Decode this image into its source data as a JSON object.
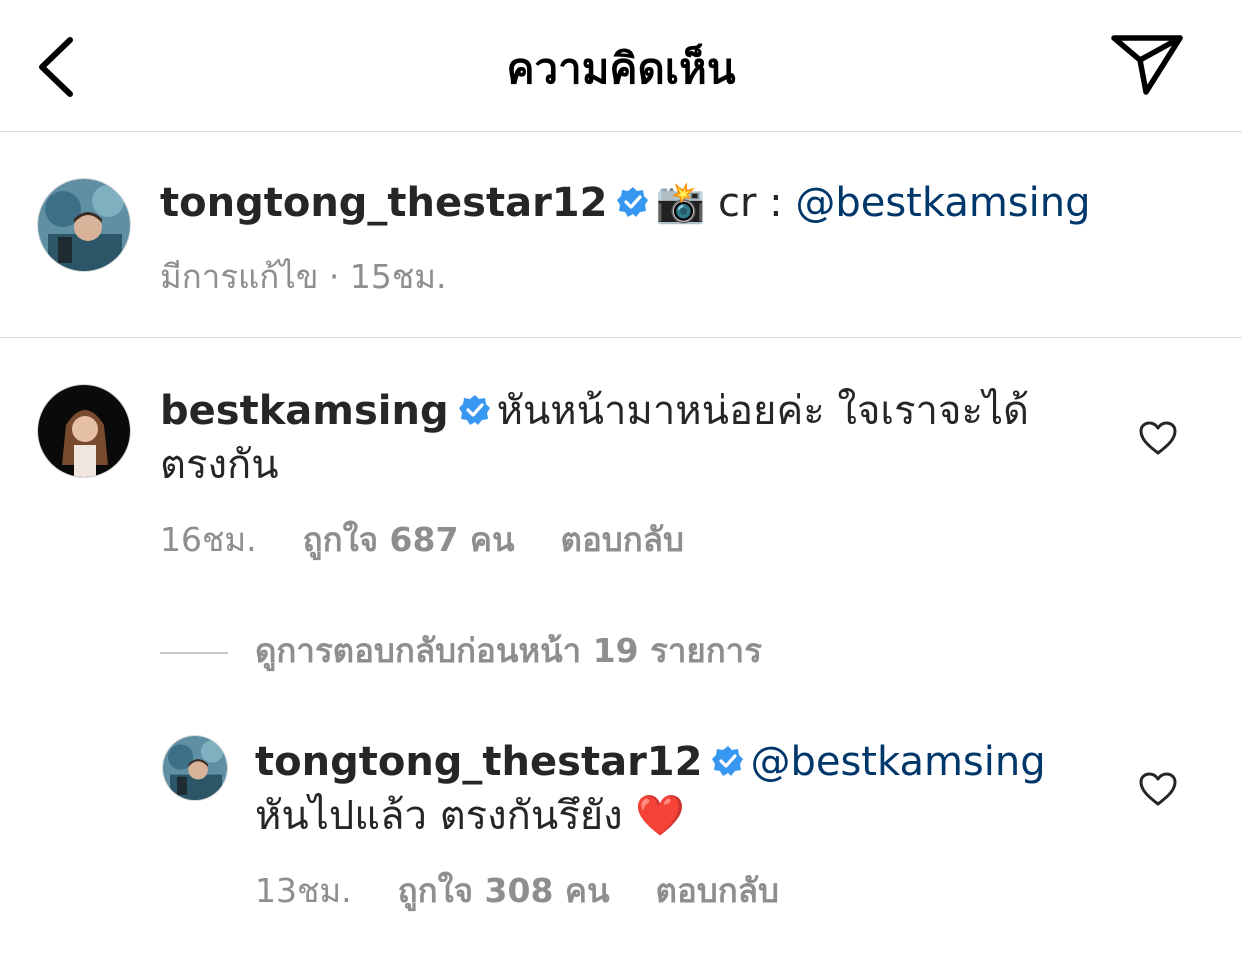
{
  "header": {
    "title": "ความคิดเห็น",
    "back_icon": "chevron-left-icon",
    "share_icon": "paper-plane-icon"
  },
  "caption": {
    "username": "tongtong_thestar12",
    "emoji": "📸",
    "text": " cr : ",
    "mention": "@bestkamsing",
    "meta": "มีการแก้ไข · 15ชม."
  },
  "comments": [
    {
      "username": "bestkamsing",
      "text": "หันหน้ามาหน่อยค่ะ ใจเราจะได้ตรงกัน",
      "time": "16ชม.",
      "likes": "ถูกใจ 687 คน",
      "reply": "ตอบกลับ"
    }
  ],
  "view_replies": "ดูการตอบกลับก่อนหน้า 19 รายการ",
  "reply": {
    "username": "tongtong_thestar12",
    "mention": "@bestkamsing",
    "text": " หันไปแล้ว ตรงกันรึยัง ",
    "emoji": "❤️",
    "time": "13ชม.",
    "likes": "ถูกใจ 308 คน",
    "reply": "ตอบกลับ"
  },
  "colors": {
    "verified": "#3897f0",
    "mention": "#00376b",
    "meta": "#8e8e8e",
    "divider": "#dbdbdb"
  }
}
